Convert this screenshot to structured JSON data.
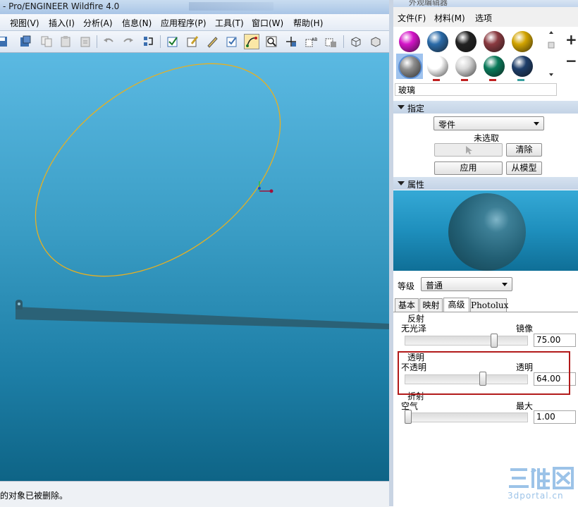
{
  "main_window": {
    "title": "- Pro/ENGINEER Wildfire 4.0",
    "menus": [
      "视图(V)",
      "插入(I)",
      "分析(A)",
      "信息(N)",
      "应用程序(P)",
      "工具(T)",
      "窗口(W)",
      "帮助(H)"
    ],
    "status_message": "的对象已被删除。"
  },
  "editor": {
    "title": "外观编辑器",
    "menus": [
      "文件(F)",
      "材料(M)",
      "选项"
    ],
    "material_name": "玻璃",
    "swatch_colors": [
      "#d414c8",
      "#2a6aa8",
      "#222222",
      "#8a3a40",
      "#d2a400",
      "#8e8e8e",
      "#ffffff",
      "#d8d8d8",
      "#0a7a5a",
      "#1e3e6a"
    ],
    "assign": {
      "header": "指定",
      "type_value": "零件",
      "selection_status": "未选取",
      "clear_label": "清除",
      "apply_label": "应用",
      "from_model_label": "从模型"
    },
    "properties": {
      "header": "属性",
      "grade_label": "等级",
      "grade_value": "普通"
    },
    "tabs": [
      "基本",
      "映射",
      "高级",
      "Photolux"
    ],
    "active_tab": "高级",
    "reflection": {
      "title": "反射",
      "min_label": "无光泽",
      "max_label": "镜像",
      "value": "75.00",
      "fraction": 0.74
    },
    "transparency": {
      "title": "透明",
      "min_label": "不透明",
      "max_label": "透明",
      "value": "64.00",
      "fraction": 0.64
    },
    "refraction": {
      "title": "折射",
      "min_label": "空气",
      "max_label": "最大",
      "value": "1.00",
      "fraction": 0.0
    }
  },
  "watermark": {
    "logo": "三维网",
    "site": "3dportal.cn"
  }
}
